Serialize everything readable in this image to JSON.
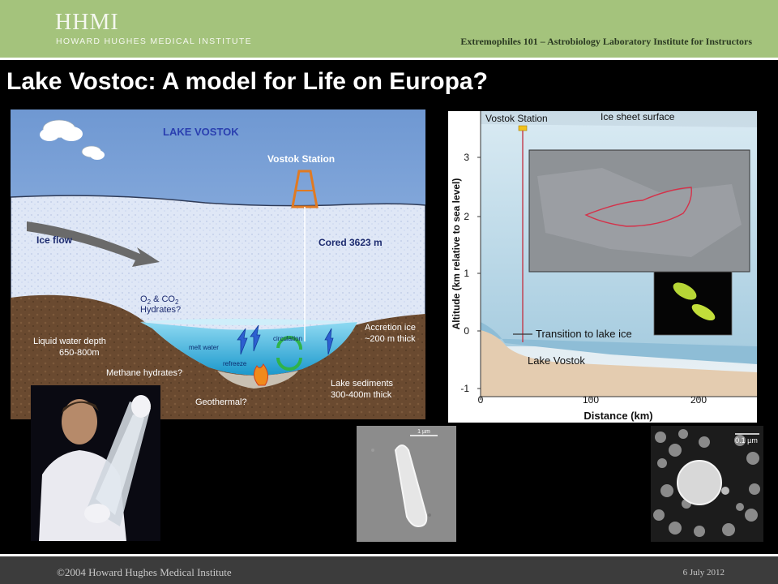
{
  "header": {
    "logo_main": "HHMI",
    "logo_sub": "HOWARD HUGHES MEDICAL INSTITUTE",
    "course": "Extremophiles 101 – Astrobiology Laboratory Institute for Instructors"
  },
  "slide": {
    "title": "Lake Vostoc: A model for Life on Europa?"
  },
  "diagram": {
    "title": "LAKE VOSTOK",
    "station": "Vostok Station",
    "ice_flow": "Ice flow",
    "cored": "Cored 3623 m",
    "hydrates_line1": "O",
    "hydrates_sub1": "2",
    "hydrates_amp": " & CO",
    "hydrates_sub2": "2",
    "hydrates_line2": "Hydrates?",
    "liquid_depth_line1": "Liquid water depth",
    "liquid_depth_line2": "650-800m",
    "melt_water": "melt water",
    "refreeze": "refreeze",
    "circulation": "circulation",
    "methane": "Methane hydrates?",
    "geothermal": "Geothermal?",
    "accretion_line1": "Accretion ice",
    "accretion_line2": "~200 m thick",
    "sediments_line1": "Lake sediments",
    "sediments_line2": "300-400m thick"
  },
  "profile": {
    "station": "Vostok Station",
    "surface": "Ice sheet surface",
    "transition": "Transition to lake ice",
    "lake": "Lake Vostok",
    "ylabel": "Altitude (km relative to sea level)",
    "xlabel": "Distance (km)",
    "yticks": [
      "3",
      "2",
      "1",
      "0",
      "-1"
    ],
    "xticks": [
      "0",
      "100",
      "200"
    ]
  },
  "micrographs": {
    "scale_left": "1 µm",
    "scale_right": "0.1 µm"
  },
  "footer": {
    "copyright": "©2004 Howard Hughes Medical Institute",
    "date": "6 July 2012"
  },
  "colors": {
    "header_green": "#a4c37c",
    "footer_gray": "#3c3c3c",
    "sky_blue": "#7fa4d8",
    "lake_water": "#27a9d6"
  },
  "icons": [
    "cloud-icon",
    "drill-tower-icon",
    "ice-flow-arrow-icon",
    "circulation-icon",
    "geothermal-flame-icon"
  ]
}
